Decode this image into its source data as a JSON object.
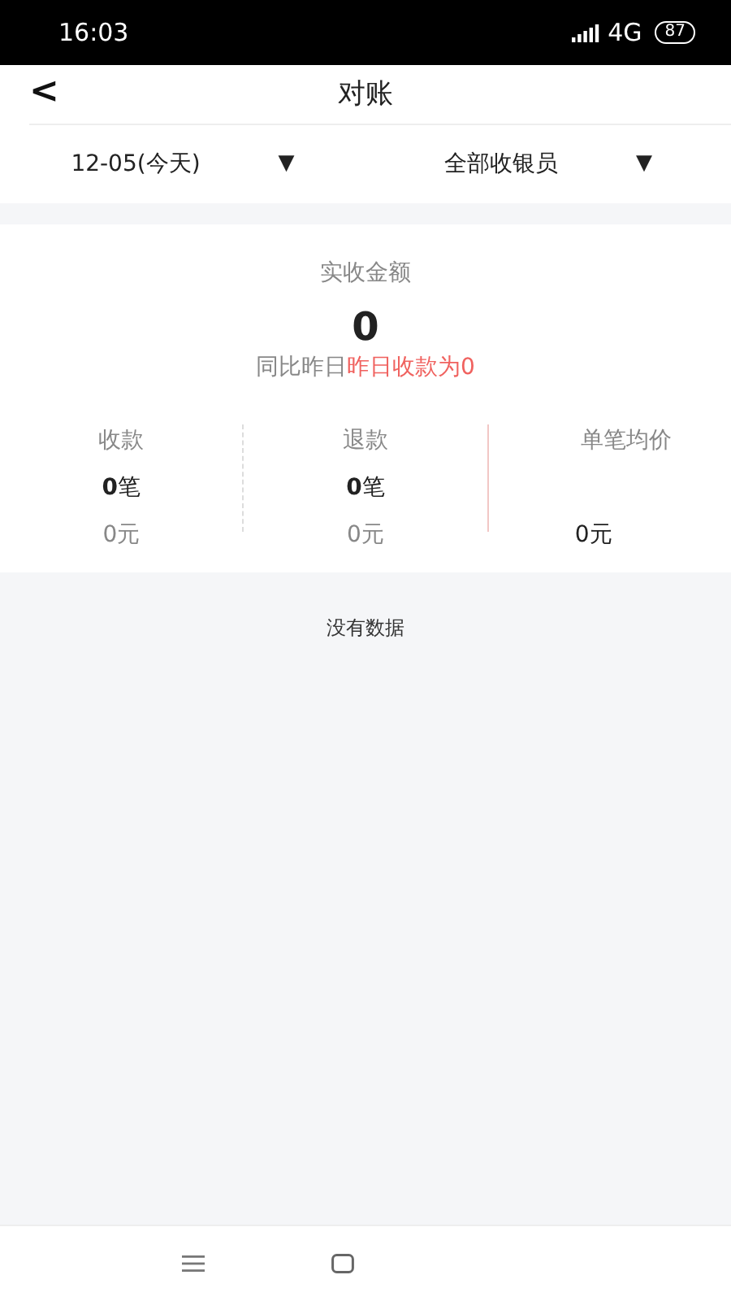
{
  "status_bar": {
    "time": "16:03",
    "network": "4G",
    "battery": "87"
  },
  "header": {
    "back": "<",
    "title": "对账"
  },
  "filters": [
    {
      "label": "12-05(今天)",
      "caret": "▼"
    },
    {
      "label": "全部收银员",
      "caret": "▼"
    }
  ],
  "summary": {
    "label": "实收金额",
    "amount": "0",
    "compare_prefix": "同比昨日",
    "compare_note": "昨日收款为0"
  },
  "stats": [
    {
      "label": "收款",
      "count": "**0**笔",
      "amount": "0元"
    },
    {
      "label": "退款",
      "count": "**0**笔",
      "amount": "0元"
    },
    {
      "label": "单笔均价",
      "amount": "0元"
    }
  ],
  "empty_message": "没有数据"
}
